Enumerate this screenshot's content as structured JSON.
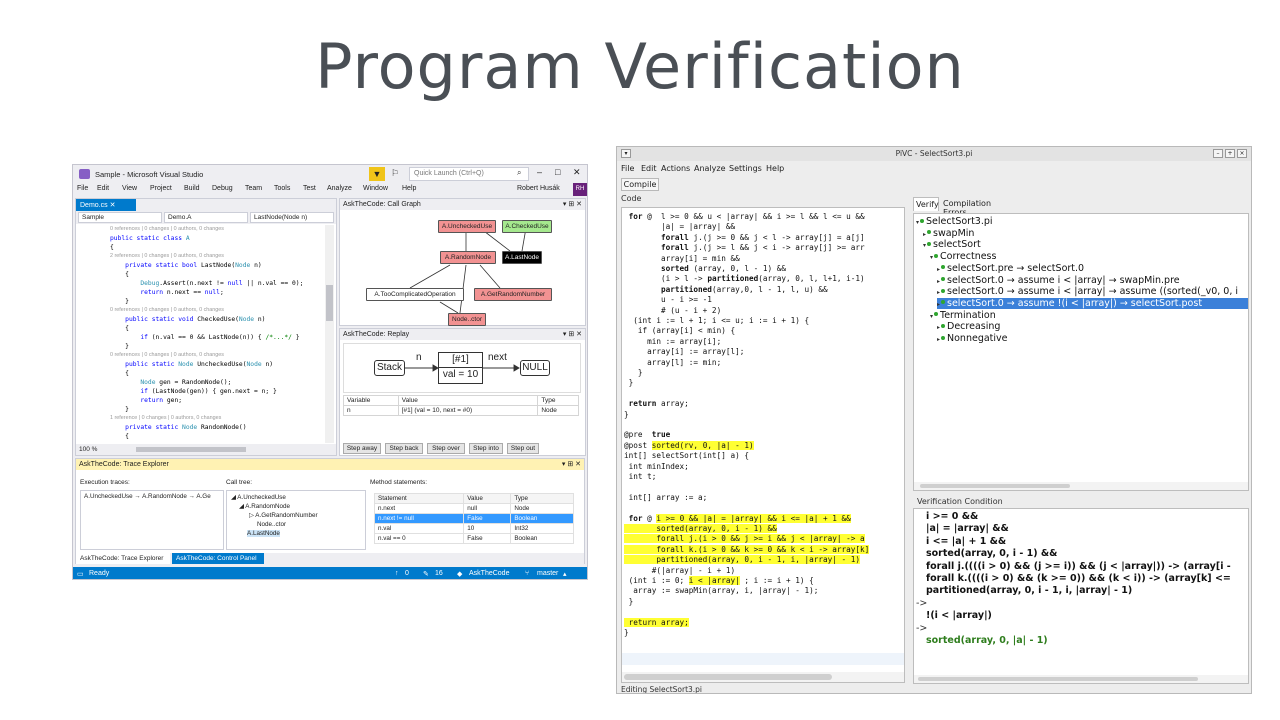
{
  "slide": {
    "title": "Program Verification"
  },
  "vs": {
    "title": "Sample - Microsoft Visual Studio",
    "quick_launch_placeholder": "Quick Launch (Ctrl+Q)",
    "menu": [
      "File",
      "Edit",
      "View",
      "Project",
      "Build",
      "Debug",
      "Team",
      "Tools",
      "Test",
      "Analyze",
      "Window",
      "Help"
    ],
    "user": "Robert Husák",
    "avatar": "RH",
    "editor": {
      "tab": "Demo.cs",
      "nav": [
        "Sample",
        "Demo.A",
        "LastNode(Node n)"
      ],
      "zoom": "100 %",
      "lines": [
        {
          "meta": true,
          "text": "0 references | 0 changes | 0 authors, 0 changes"
        },
        {
          "segs": [
            [
              "kw",
              "public static class "
            ],
            [
              "ty",
              "A"
            ]
          ]
        },
        {
          "segs": [
            [
              "",
              "{"
            ]
          ]
        },
        {
          "meta": true,
          "text": "2 references | 0 changes | 0 authors, 0 changes"
        },
        {
          "segs": [
            [
              "kw",
              "    private static bool "
            ],
            [
              "",
              "LastNode("
            ],
            [
              "ty",
              "Node "
            ],
            [
              "",
              "n)"
            ]
          ]
        },
        {
          "segs": [
            [
              "",
              "    {"
            ]
          ]
        },
        {
          "segs": [
            [
              "ty",
              "        Debug"
            ],
            [
              "",
              ".Assert(n.next != "
            ],
            [
              "kw",
              "null"
            ],
            [
              "",
              " || n.val == 0);"
            ]
          ]
        },
        {
          "segs": [
            [
              "kw",
              "        return "
            ],
            [
              "",
              "n.next == "
            ],
            [
              "kw",
              "null"
            ],
            [
              "",
              ";"
            ]
          ]
        },
        {
          "segs": [
            [
              "",
              "    }"
            ]
          ]
        },
        {
          "meta": true,
          "text": "0 references | 0 changes | 0 authors, 0 changes"
        },
        {
          "segs": [
            [
              "kw",
              "    public static void "
            ],
            [
              "",
              "CheckedUse("
            ],
            [
              "ty",
              "Node "
            ],
            [
              "",
              "n)"
            ]
          ]
        },
        {
          "segs": [
            [
              "",
              "    {"
            ]
          ]
        },
        {
          "segs": [
            [
              "kw",
              "        if "
            ],
            [
              "",
              "(n.val == 0 && LastNode(n)) { "
            ],
            [
              "cm",
              "/*...*/"
            ],
            [
              "",
              " }"
            ]
          ]
        },
        {
          "segs": [
            [
              "",
              "    }"
            ]
          ]
        },
        {
          "meta": true,
          "text": "0 references | 0 changes | 0 authors, 0 changes"
        },
        {
          "segs": [
            [
              "kw",
              "    public static "
            ],
            [
              "ty",
              "Node "
            ],
            [
              "",
              "UncheckedUse("
            ],
            [
              "ty",
              "Node "
            ],
            [
              "",
              "n)"
            ]
          ]
        },
        {
          "segs": [
            [
              "",
              "    {"
            ]
          ]
        },
        {
          "segs": [
            [
              "ty",
              "        Node "
            ],
            [
              "",
              "gen = RandomNode();"
            ]
          ]
        },
        {
          "segs": [
            [
              "kw",
              "        if "
            ],
            [
              "",
              "(LastNode(gen)) { gen.next = n; }"
            ]
          ]
        },
        {
          "segs": [
            [
              "kw",
              "        return "
            ],
            [
              "",
              "gen;"
            ]
          ]
        },
        {
          "segs": [
            [
              "",
              "    }"
            ]
          ]
        },
        {
          "meta": true,
          "text": "1 reference | 0 changes | 0 authors, 0 changes"
        },
        {
          "segs": [
            [
              "kw",
              "    private static "
            ],
            [
              "ty",
              "Node "
            ],
            [
              "",
              "RandomNode()"
            ]
          ]
        },
        {
          "segs": [
            [
              "",
              "    {"
            ]
          ]
        }
      ]
    },
    "call_graph": {
      "title": "AskTheCode: Call Graph",
      "nodes": [
        "A.UncheckedUse",
        "A.CheckedUse",
        "A.RandomNode",
        "A.LastNode",
        "A.TooComplicatedOperation",
        "A.GetRandomNumber",
        "Node..ctor"
      ]
    },
    "replay": {
      "title": "AskTheCode: Replay",
      "stack": "Stack",
      "edge_n": "n",
      "node_id": "[#1]",
      "node_val": "val = 10",
      "edge_next": "next",
      "null": "NULL",
      "headers": [
        "Variable",
        "Value",
        "Type"
      ],
      "rows": [
        [
          "n",
          "[#1] (val = 10, next = #0)",
          "Node"
        ]
      ],
      "buttons": [
        "Step away",
        "Step back",
        "Step over",
        "Step into",
        "Step out"
      ]
    },
    "trace": {
      "title": "AskTheCode: Trace Explorer",
      "exec_label": "Execution traces:",
      "exec_item": "A.UncheckedUse → A.RandomNode → A.Ge",
      "call_label": "Call tree:",
      "call_tree": [
        "A.UncheckedUse",
        "A.RandomNode",
        "A.GetRandomNumber",
        "Node..ctor",
        "A.LastNode"
      ],
      "method_label": "Method statements:",
      "headers": [
        "Statement",
        "Value",
        "Type"
      ],
      "rows": [
        [
          "n.next",
          "null",
          "Node"
        ],
        [
          "n.next != null",
          "False",
          "Boolean"
        ],
        [
          "n.val",
          "10",
          "Int32"
        ],
        [
          "n.val == 0",
          "False",
          "Boolean"
        ]
      ],
      "tabs": [
        "AskTheCode: Trace Explorer",
        "AskTheCode: Control Panel"
      ]
    },
    "status": {
      "ready": "Ready",
      "up": "0",
      "edits": "16",
      "repo": "AskTheCode",
      "branch": "master"
    }
  },
  "pivc": {
    "title": "PiVC - SelectSort3.pi",
    "menu": [
      "File",
      "Edit",
      "Actions",
      "Analyze",
      "Settings",
      "Help"
    ],
    "compile": "Compile",
    "code_label": "Code",
    "status": "Editing SelectSort3.pi",
    "code_lines": [
      {
        "segs": [
          [
            "b",
            " for "
          ],
          [
            "",
            "@  l >= 0 && u < |array| && i >= l && l <= u &&"
          ]
        ]
      },
      {
        "segs": [
          [
            "",
            "        |a| = |array| &&"
          ]
        ]
      },
      {
        "segs": [
          [
            "b",
            "        forall "
          ],
          [
            "",
            "j.(j >= 0 && j < l -> array[j] = a[j]"
          ]
        ]
      },
      {
        "segs": [
          [
            "b",
            "        forall "
          ],
          [
            "",
            "j.(j >= l && j < i -> array[j] >= arr"
          ]
        ]
      },
      {
        "segs": [
          [
            "",
            "        array[i] = min &&"
          ]
        ]
      },
      {
        "segs": [
          [
            "b",
            "        sorted "
          ],
          [
            "",
            "(array, 0, l - 1) &&"
          ]
        ]
      },
      {
        "segs": [
          [
            "",
            "        (i > l -> "
          ],
          [
            "b",
            "partitioned"
          ],
          [
            "",
            "(array, 0, l, l+1, i-1)"
          ]
        ]
      },
      {
        "segs": [
          [
            "b",
            "        partitioned"
          ],
          [
            "",
            "(array,0, l - 1, l, u) &&"
          ]
        ]
      },
      {
        "segs": [
          [
            "",
            "        u - i >= -1"
          ]
        ]
      },
      {
        "segs": [
          [
            "",
            "        # (u - i + 2)"
          ]
        ]
      },
      {
        "segs": [
          [
            "",
            "  (int i := l + 1; i <= u; i := i + 1) {"
          ]
        ]
      },
      {
        "segs": [
          [
            "",
            "   if (array[i] < min) {"
          ]
        ]
      },
      {
        "segs": [
          [
            "",
            "     min := array[i];"
          ]
        ]
      },
      {
        "segs": [
          [
            "",
            "     array[i] := array[l];"
          ]
        ]
      },
      {
        "segs": [
          [
            "",
            "     array[l] := min;"
          ]
        ]
      },
      {
        "segs": [
          [
            "",
            "   }"
          ]
        ]
      },
      {
        "segs": [
          [
            "",
            " }"
          ]
        ]
      },
      {
        "segs": [
          [
            "",
            ""
          ]
        ]
      },
      {
        "segs": [
          [
            "b",
            " return "
          ],
          [
            "",
            "array;"
          ]
        ]
      },
      {
        "segs": [
          [
            "",
            "}"
          ]
        ]
      },
      {
        "segs": [
          [
            "",
            ""
          ]
        ]
      },
      {
        "segs": [
          [
            "",
            "@pre  "
          ],
          [
            "b",
            "true"
          ]
        ]
      },
      {
        "segs": [
          [
            "",
            "@post "
          ],
          [
            "hl",
            "sorted(rv, 0, |a| - 1)"
          ]
        ]
      },
      {
        "segs": [
          [
            "",
            "int[] selectSort(int[] a) {"
          ]
        ]
      },
      {
        "segs": [
          [
            "",
            " int minIndex;"
          ]
        ]
      },
      {
        "segs": [
          [
            "",
            " int t;"
          ]
        ]
      },
      {
        "segs": [
          [
            "",
            ""
          ]
        ]
      },
      {
        "segs": [
          [
            "",
            " int[] array := a;"
          ]
        ]
      },
      {
        "segs": [
          [
            "",
            ""
          ]
        ]
      },
      {
        "segs": [
          [
            "b",
            " for "
          ],
          [
            "",
            "@ "
          ],
          [
            "hl",
            "i >= 0 && |a| = |array| && i <= |a| + 1 &&"
          ]
        ]
      },
      {
        "segs": [
          [
            "hl",
            "       sorted(array, 0, i - 1) &&"
          ]
        ]
      },
      {
        "segs": [
          [
            "hl",
            "       forall j.(i > 0 && j >= i && j < |array| -> a"
          ]
        ]
      },
      {
        "segs": [
          [
            "hl",
            "       forall k.(i > 0 && k >= 0 && k < i -> array[k]"
          ]
        ]
      },
      {
        "segs": [
          [
            "hl",
            "       partitioned(array, 0, i - 1, i, |array| - 1)"
          ]
        ]
      },
      {
        "segs": [
          [
            "",
            "      #(|array| - i + 1)"
          ]
        ]
      },
      {
        "segs": [
          [
            "",
            " (int i := 0; "
          ],
          [
            "hl",
            "i < |array|"
          ],
          [
            "",
            " ; i := i + 1) {"
          ]
        ]
      },
      {
        "segs": [
          [
            "",
            "  array := swapMin(array, i, |array| - 1);"
          ]
        ]
      },
      {
        "segs": [
          [
            "",
            " }"
          ]
        ]
      },
      {
        "segs": [
          [
            "",
            ""
          ]
        ]
      },
      {
        "segs": [
          [
            "hl",
            " return array;"
          ]
        ]
      },
      {
        "segs": [
          [
            "",
            "}"
          ]
        ]
      }
    ],
    "right_tabs": [
      "Verify",
      "Compilation Errors"
    ],
    "tree": [
      {
        "level": 0,
        "arrow": "▾",
        "label": "SelectSort3.pi"
      },
      {
        "level": 1,
        "arrow": "▸",
        "label": "swapMin"
      },
      {
        "level": 1,
        "arrow": "▾",
        "label": "selectSort"
      },
      {
        "level": 2,
        "arrow": "▾",
        "label": "Correctness"
      },
      {
        "level": 3,
        "arrow": "▸",
        "label": "selectSort.pre → selectSort.0"
      },
      {
        "level": 3,
        "arrow": "▸",
        "label": "selectSort.0 → assume i < |array| → swapMin.pre"
      },
      {
        "level": 3,
        "arrow": "▸",
        "label": "selectSort.0 → assume i < |array| → assume ((sorted(_v0, 0, i"
      },
      {
        "level": 3,
        "arrow": "▸",
        "label": "selectSort.0 → assume !(i < |array|) → selectSort.post",
        "selected": true
      },
      {
        "level": 2,
        "arrow": "▾",
        "label": "Termination"
      },
      {
        "level": 3,
        "arrow": "▸",
        "label": "Decreasing"
      },
      {
        "level": 3,
        "arrow": "▸",
        "label": "Nonnegative"
      }
    ],
    "vc_label": "Verification Condition",
    "vc_lines": [
      {
        "kind": "b",
        "indent": 1,
        "text": "i >= 0 &&"
      },
      {
        "kind": "b",
        "indent": 1,
        "text": "|a| = |array| &&"
      },
      {
        "kind": "b",
        "indent": 1,
        "text": "i <= |a| + 1 &&"
      },
      {
        "kind": "b",
        "indent": 1,
        "text": "sorted(array, 0, i - 1) &&"
      },
      {
        "kind": "b",
        "indent": 1,
        "text": "forall j.((((i > 0) && (j >= i)) && (j < |array|)) -> (array[i -"
      },
      {
        "kind": "b",
        "indent": 1,
        "text": "forall k.((((i > 0) && (k >= 0)) && (k < i)) -> (array[k] <="
      },
      {
        "kind": "b",
        "indent": 1,
        "text": "partitioned(array, 0, i - 1, i, |array| - 1)"
      },
      {
        "kind": "arrow",
        "indent": 0,
        "text": "->"
      },
      {
        "kind": "b",
        "indent": 1,
        "text": "!(i < |array|)"
      },
      {
        "kind": "arrow",
        "indent": 0,
        "text": "->"
      },
      {
        "kind": "green",
        "indent": 1,
        "text": "sorted(array, 0, |a| - 1)"
      }
    ]
  }
}
